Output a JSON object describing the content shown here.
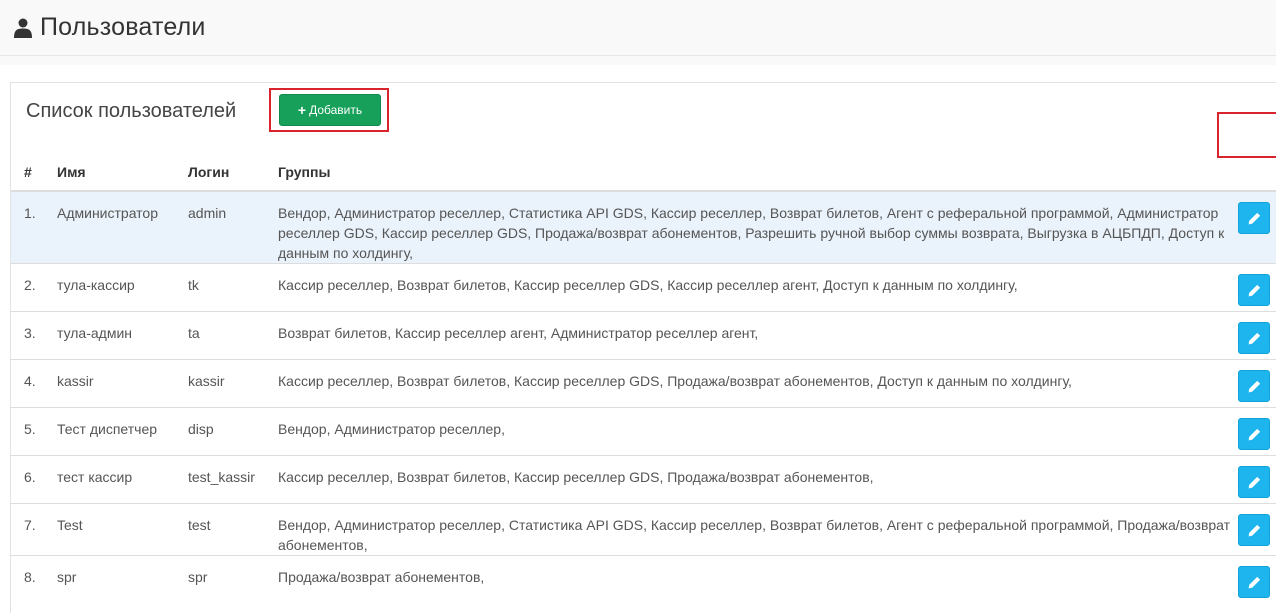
{
  "header": {
    "title": "Пользователи",
    "icon": "user-icon"
  },
  "panel": {
    "list_title": "Список пользователей",
    "add_label": "Добавить",
    "add_icon": "plus-icon"
  },
  "table": {
    "columns": [
      "#",
      "Имя",
      "Логин",
      "Группы"
    ],
    "rows": [
      {
        "num": "1.",
        "name": "Администратор",
        "login": "admin",
        "groups": "Вендор, Администратор реселлер, Статистика API GDS, Кассир реселлер, Возврат билетов, Агент с реферальной программой, Администратор реселлер GDS, Кассир реселлер GDS, Продажа/возврат абонементов, Разрешить ручной выбор суммы возврата, Выгрузка в АЦБПДП, Доступ к данным по холдингу,"
      },
      {
        "num": "2.",
        "name": "тула-кассир",
        "login": "tk",
        "groups": "Кассир реселлер, Возврат билетов, Кассир реселлер GDS, Кассир реселлер агент, Доступ к данным по холдингу,"
      },
      {
        "num": "3.",
        "name": "тула-админ",
        "login": "ta",
        "groups": "Возврат билетов, Кассир реселлер агент, Администратор реселлер агент,"
      },
      {
        "num": "4.",
        "name": "kassir",
        "login": "kassir",
        "groups": "Кассир реселлер, Возврат билетов, Кассир реселлер GDS, Продажа/возврат абонементов, Доступ к данным по холдингу,"
      },
      {
        "num": "5.",
        "name": "Тест диспетчер",
        "login": "disp",
        "groups": "Вендор, Администратор реселлер,"
      },
      {
        "num": "6.",
        "name": "тест кассир",
        "login": "test_kassir",
        "groups": "Кассир реселлер, Возврат билетов, Кассир реселлер GDS, Продажа/возврат абонементов,"
      },
      {
        "num": "7.",
        "name": "Test",
        "login": "test",
        "groups": "Вендор, Администратор реселлер, Статистика API GDS, Кассир реселлер, Возврат билетов, Агент с реферальной программой, Продажа/возврат абонементов,"
      },
      {
        "num": "8.",
        "name": "spr",
        "login": "spr",
        "groups": "Продажа/возврат абонементов,"
      }
    ],
    "edit_icon": "pencil-icon"
  },
  "colors": {
    "add_button": "#17a05a",
    "edit_button": "#1eb5ef",
    "highlight": "#d9232d",
    "selected_row": "#eaf2fb"
  }
}
